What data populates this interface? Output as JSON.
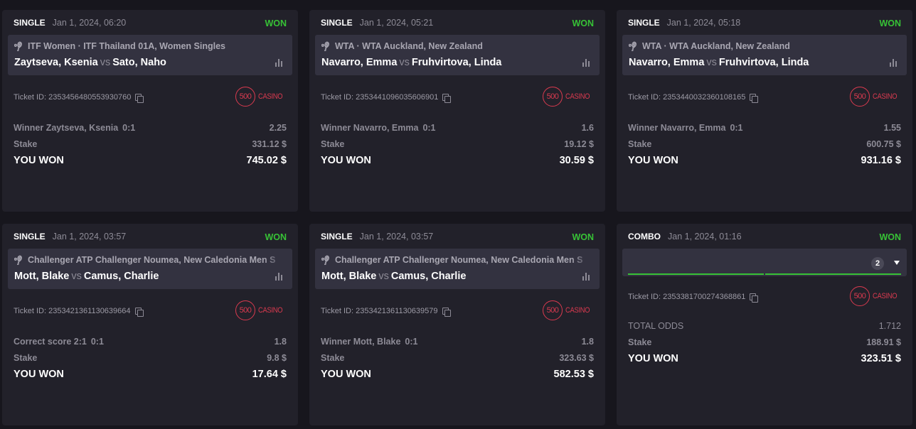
{
  "colors": {
    "background": "#17161d",
    "card": "#22212a",
    "event_box": "#333240",
    "won": "#37c236",
    "casino_logo": "#d93a4f"
  },
  "logo": {
    "number": "500",
    "word": "CASINO"
  },
  "bets": [
    {
      "type": "SINGLE",
      "date": "Jan 1, 2024, 06:20",
      "status": "WON",
      "league": "ITF Women · ITF Thailand 01A, Women Singles",
      "home": "Zaytseva, Ksenia",
      "vs": "vs",
      "away": "Sato, Naho",
      "ticket": "Ticket ID: 2353456480553930760",
      "selection": "Winner Zaytseva, Ksenia",
      "score": "0:1",
      "odds": "2.25",
      "stake_label": "Stake",
      "stake": "331.12 $",
      "result_label": "YOU WON",
      "payout": "745.02 $"
    },
    {
      "type": "SINGLE",
      "date": "Jan 1, 2024, 05:21",
      "status": "WON",
      "league": "WTA · WTA Auckland, New Zealand",
      "home": "Navarro, Emma",
      "vs": "vs",
      "away": "Fruhvirtova, Linda",
      "ticket": "Ticket ID: 2353441096035606901",
      "selection": "Winner Navarro, Emma",
      "score": "0:1",
      "odds": "1.6",
      "stake_label": "Stake",
      "stake": "19.12 $",
      "result_label": "YOU WON",
      "payout": "30.59 $"
    },
    {
      "type": "SINGLE",
      "date": "Jan 1, 2024, 05:18",
      "status": "WON",
      "league": "WTA · WTA Auckland, New Zealand",
      "home": "Navarro, Emma",
      "vs": "vs",
      "away": "Fruhvirtova, Linda",
      "ticket": "Ticket ID: 2353440032360108165",
      "selection": "Winner Navarro, Emma",
      "score": "0:1",
      "odds": "1.55",
      "stake_label": "Stake",
      "stake": "600.75 $",
      "result_label": "YOU WON",
      "payout": "931.16 $"
    },
    {
      "type": "SINGLE",
      "date": "Jan 1, 2024, 03:57",
      "status": "WON",
      "league": "Challenger ATP Challenger Noumea, New Caledonia Men S",
      "home": "Mott, Blake",
      "vs": "vs",
      "away": "Camus, Charlie",
      "ticket": "Ticket ID: 2353421361130639664",
      "selection": "Correct score 2:1",
      "score": "0:1",
      "odds": "1.8",
      "stake_label": "Stake",
      "stake": "9.8 $",
      "result_label": "YOU WON",
      "payout": "17.64 $"
    },
    {
      "type": "SINGLE",
      "date": "Jan 1, 2024, 03:57",
      "status": "WON",
      "league": "Challenger ATP Challenger Noumea, New Caledonia Men S",
      "home": "Mott, Blake",
      "vs": "vs",
      "away": "Camus, Charlie",
      "ticket": "Ticket ID: 2353421361130639579",
      "selection": "Winner Mott, Blake",
      "score": "0:1",
      "odds": "1.8",
      "stake_label": "Stake",
      "stake": "323.63 $",
      "result_label": "YOU WON",
      "payout": "582.53 $"
    }
  ],
  "combo": {
    "type": "COMBO",
    "date": "Jan 1, 2024, 01:16",
    "status": "WON",
    "count": "2",
    "ticket": "Ticket ID: 2353381700274368861",
    "odds_label": "TOTAL ODDS",
    "odds": "1.712",
    "stake_label": "Stake",
    "stake": "188.91 $",
    "result_label": "YOU WON",
    "payout": "323.51 $"
  }
}
